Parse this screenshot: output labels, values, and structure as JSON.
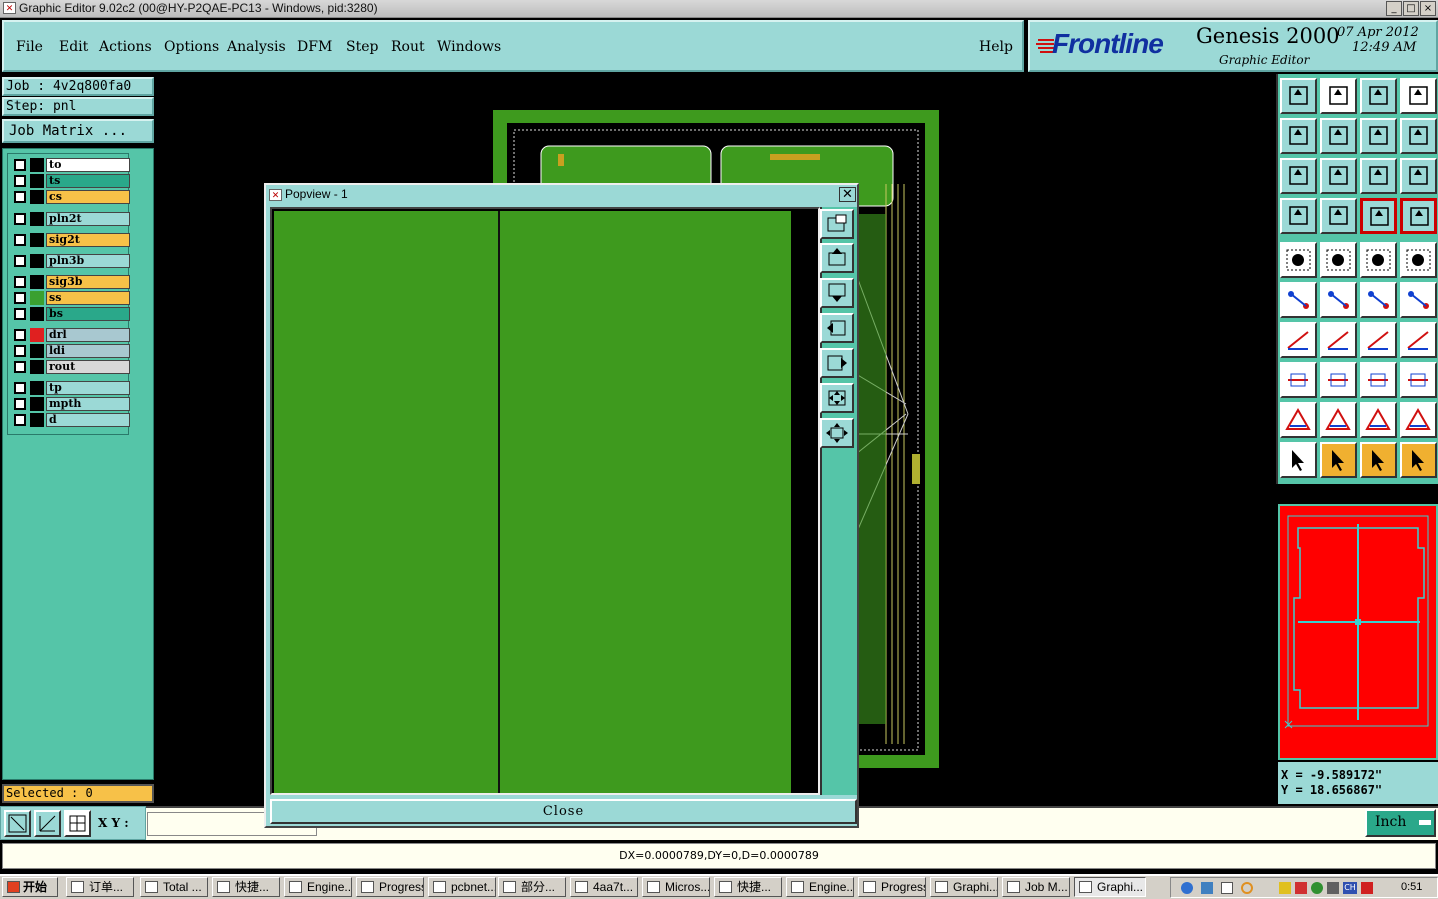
{
  "window": {
    "title": "Graphic Editor 9.02c2 (00@HY-P2QAE-PC13 - Windows, pid:3280)",
    "controls": [
      "_",
      "□",
      "×"
    ]
  },
  "menu": {
    "items": [
      "File",
      "Edit",
      "Actions",
      "Options",
      "Analysis",
      "DFM",
      "Step",
      "Rout",
      "Windows"
    ],
    "help": "Help"
  },
  "brand": {
    "logo": "Frontline",
    "product": "Genesis 2000",
    "subtitle": "Graphic Editor",
    "date": "07 Apr 2012",
    "time": "12:49 AM"
  },
  "job": {
    "job_label": "Job : 4v2q800fa0",
    "step_label": "Step: pnl",
    "matrix_button": "Job Matrix ..."
  },
  "layers": [
    {
      "name": "to",
      "color": "#ffffff",
      "swatch": "#000000"
    },
    {
      "name": "ts",
      "color": "#2aa88a",
      "swatch": "#000000"
    },
    {
      "name": "cs",
      "color": "#f7c148",
      "swatch": "#000000"
    },
    {
      "name": "pln2t",
      "color": "#9bd9d6",
      "swatch": "#000000"
    },
    {
      "name": "sig2t",
      "color": "#f7c148",
      "swatch": "#000000"
    },
    {
      "name": "pln3b",
      "color": "#9bd9d6",
      "swatch": "#000000"
    },
    {
      "name": "sig3b",
      "color": "#f7c148",
      "swatch": "#000000"
    },
    {
      "name": "ss",
      "color": "#f7c148",
      "swatch": "#3aa030"
    },
    {
      "name": "bs",
      "color": "#2aa88a",
      "swatch": "#000000"
    },
    {
      "name": "drl",
      "color": "#a8c8d0",
      "swatch": "#e02020"
    },
    {
      "name": "ldi",
      "color": "#a8c8d0",
      "swatch": "#000000"
    },
    {
      "name": "rout",
      "color": "#d8d8d8",
      "swatch": "#000000"
    },
    {
      "name": "tp",
      "color": "#9bd9d6",
      "swatch": "#000000"
    },
    {
      "name": "mpth",
      "color": "#9bd9d6",
      "swatch": "#000000"
    },
    {
      "name": "d",
      "color": "#9bd9d6",
      "swatch": "#000000"
    }
  ],
  "selected": "Selected : 0",
  "popup": {
    "title": "Popview - 1",
    "close_label": "Close"
  },
  "coords": {
    "x": "X = -9.589172\"",
    "y": "Y = 18.656867\""
  },
  "xy_label": "X Y :",
  "units": "Inch",
  "status": "DX=0.0000789,DY=0,D=0.0000789",
  "taskbar": {
    "start": "开始",
    "tasks": [
      "订单...",
      "Total ...",
      "快捷...",
      "Engine...",
      "Progress",
      "pcbnet...",
      "部分...",
      "4aa7t...",
      "Micros...",
      "快捷...",
      "Engine...",
      "Progress",
      "Graphi...",
      "Job M...",
      "Graphi..."
    ],
    "clock": "0:51"
  }
}
